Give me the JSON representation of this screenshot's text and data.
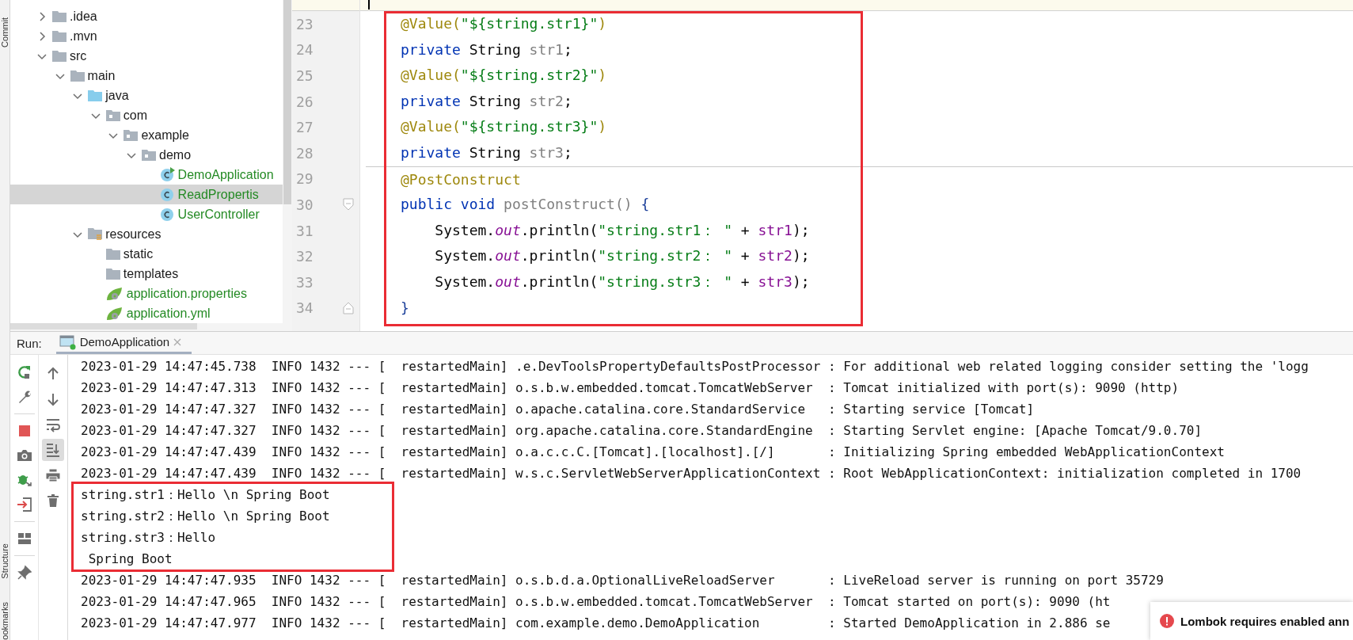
{
  "side_tabs": [
    {
      "label": "Commit"
    },
    {
      "label": "Structure"
    },
    {
      "label": "ookmarks"
    }
  ],
  "project_tree": [
    {
      "label": ".idea",
      "kind": "folder",
      "expanded": false,
      "selected": false
    },
    {
      "label": ".mvn",
      "kind": "folder",
      "expanded": false,
      "selected": false
    },
    {
      "label": "src",
      "kind": "folder",
      "expanded": true,
      "selected": false,
      "children": [
        {
          "label": "main",
          "kind": "folder",
          "expanded": true,
          "selected": false,
          "children": [
            {
              "label": "java",
              "kind": "source-folder",
              "expanded": true,
              "selected": false,
              "children": [
                {
                  "label": "com",
                  "kind": "package",
                  "expanded": true,
                  "selected": false,
                  "children": [
                    {
                      "label": "example",
                      "kind": "package",
                      "expanded": true,
                      "selected": false,
                      "children": [
                        {
                          "label": "demo",
                          "kind": "package",
                          "expanded": true,
                          "selected": false,
                          "children": [
                            {
                              "label": "DemoApplication",
                              "kind": "main-class",
                              "selected": false
                            },
                            {
                              "label": "ReadPropertis",
                              "kind": "class",
                              "selected": true
                            },
                            {
                              "label": "UserController",
                              "kind": "class",
                              "selected": false
                            }
                          ]
                        }
                      ]
                    }
                  ]
                }
              ]
            },
            {
              "label": "resources",
              "kind": "resources",
              "expanded": true,
              "selected": false,
              "children": [
                {
                  "label": "static",
                  "kind": "folder",
                  "selected": false
                },
                {
                  "label": "templates",
                  "kind": "folder",
                  "selected": false
                },
                {
                  "label": "application.properties",
                  "kind": "spring-config",
                  "selected": false
                },
                {
                  "label": "application.yml",
                  "kind": "spring-config",
                  "selected": false
                }
              ]
            }
          ]
        }
      ]
    }
  ],
  "editor": {
    "framed": true,
    "lines": [
      {
        "number": "23",
        "fold_start": false,
        "fold_end": false,
        "separator_above": false,
        "tokens": [
          {
            "text": "@Value(",
            "kind": "annotation"
          },
          {
            "text": "\"${string.str1}\"",
            "kind": "string"
          },
          {
            "text": ")",
            "kind": "annotation"
          }
        ]
      },
      {
        "number": "24",
        "fold_start": false,
        "fold_end": false,
        "separator_above": false,
        "tokens": [
          {
            "text": "private",
            "kind": "keyword"
          },
          {
            "text": " String ",
            "kind": "plain"
          },
          {
            "text": "str1",
            "kind": "unused"
          },
          {
            "text": ";",
            "kind": "plain"
          }
        ]
      },
      {
        "number": "25",
        "fold_start": false,
        "fold_end": false,
        "separator_above": false,
        "tokens": [
          {
            "text": "@Value(",
            "kind": "annotation"
          },
          {
            "text": "\"${string.str2}\"",
            "kind": "string"
          },
          {
            "text": ")",
            "kind": "annotation"
          }
        ]
      },
      {
        "number": "26",
        "fold_start": false,
        "fold_end": false,
        "separator_above": false,
        "tokens": [
          {
            "text": "private",
            "kind": "keyword"
          },
          {
            "text": " String ",
            "kind": "plain"
          },
          {
            "text": "str2",
            "kind": "unused"
          },
          {
            "text": ";",
            "kind": "plain"
          }
        ]
      },
      {
        "number": "27",
        "fold_start": false,
        "fold_end": false,
        "separator_above": false,
        "tokens": [
          {
            "text": "@Value(",
            "kind": "annotation"
          },
          {
            "text": "\"${string.str3}\"",
            "kind": "string"
          },
          {
            "text": ")",
            "kind": "annotation"
          }
        ]
      },
      {
        "number": "28",
        "fold_start": false,
        "fold_end": false,
        "separator_above": false,
        "tokens": [
          {
            "text": "private",
            "kind": "keyword"
          },
          {
            "text": " String ",
            "kind": "plain"
          },
          {
            "text": "str3",
            "kind": "unused"
          },
          {
            "text": ";",
            "kind": "plain"
          }
        ]
      },
      {
        "number": "29",
        "fold_start": false,
        "fold_end": false,
        "separator_above": true,
        "tokens": [
          {
            "text": "@PostConstruct",
            "kind": "annotation"
          }
        ]
      },
      {
        "number": "30",
        "fold_start": true,
        "fold_end": false,
        "separator_above": false,
        "tokens": [
          {
            "text": "public void",
            "kind": "keyword"
          },
          {
            "text": " postConstruct()",
            "kind": "unused"
          },
          {
            "text": " {",
            "kind": "brace"
          }
        ]
      },
      {
        "number": "31",
        "fold_start": false,
        "fold_end": false,
        "separator_above": false,
        "tokens": [
          {
            "text": "    System.",
            "kind": "plain"
          },
          {
            "text": "out",
            "kind": "static"
          },
          {
            "text": ".println(",
            "kind": "plain"
          },
          {
            "text": "\"string.str1： \"",
            "kind": "string"
          },
          {
            "text": " + ",
            "kind": "plain"
          },
          {
            "text": "str1",
            "kind": "field"
          },
          {
            "text": ");",
            "kind": "plain"
          }
        ]
      },
      {
        "number": "32",
        "fold_start": false,
        "fold_end": false,
        "separator_above": false,
        "tokens": [
          {
            "text": "    System.",
            "kind": "plain"
          },
          {
            "text": "out",
            "kind": "static"
          },
          {
            "text": ".println(",
            "kind": "plain"
          },
          {
            "text": "\"string.str2： \"",
            "kind": "string"
          },
          {
            "text": " + ",
            "kind": "plain"
          },
          {
            "text": "str2",
            "kind": "field"
          },
          {
            "text": ");",
            "kind": "plain"
          }
        ]
      },
      {
        "number": "33",
        "fold_start": false,
        "fold_end": false,
        "separator_above": false,
        "tokens": [
          {
            "text": "    System.",
            "kind": "plain"
          },
          {
            "text": "out",
            "kind": "static"
          },
          {
            "text": ".println(",
            "kind": "plain"
          },
          {
            "text": "\"string.str3： \"",
            "kind": "string"
          },
          {
            "text": " + ",
            "kind": "plain"
          },
          {
            "text": "str3",
            "kind": "field"
          },
          {
            "text": ");",
            "kind": "plain"
          }
        ]
      },
      {
        "number": "34",
        "fold_start": false,
        "fold_end": true,
        "separator_above": false,
        "tokens": [
          {
            "text": "}",
            "kind": "brace"
          }
        ]
      }
    ]
  },
  "run_panel": {
    "title": "Run:",
    "tabs": [
      {
        "label": "DemoApplication",
        "selected": true
      }
    ],
    "console_toolbar": [
      {
        "kind": "up",
        "on": false
      },
      {
        "kind": "down",
        "on": false
      },
      {
        "kind": "soft-wrap",
        "on": false
      },
      {
        "kind": "scroll-to-end",
        "on": true
      },
      {
        "kind": "print",
        "on": false
      },
      {
        "kind": "trash",
        "on": false
      }
    ],
    "console": [
      {
        "framed": false,
        "lines": [
          "2023-01-29 14:47:45.738  INFO 1432 --- [  restartedMain] .e.DevToolsPropertyDefaultsPostProcessor : For additional web related logging consider setting the 'logg",
          "2023-01-29 14:47:47.313  INFO 1432 --- [  restartedMain] o.s.b.w.embedded.tomcat.TomcatWebServer  : Tomcat initialized with port(s): 9090 (http)",
          "2023-01-29 14:47:47.327  INFO 1432 --- [  restartedMain] o.apache.catalina.core.StandardService   : Starting service [Tomcat]",
          "2023-01-29 14:47:47.327  INFO 1432 --- [  restartedMain] org.apache.catalina.core.StandardEngine  : Starting Servlet engine: [Apache Tomcat/9.0.70]",
          "2023-01-29 14:47:47.439  INFO 1432 --- [  restartedMain] o.a.c.c.C.[Tomcat].[localhost].[/]       : Initializing Spring embedded WebApplicationContext",
          "2023-01-29 14:47:47.439  INFO 1432 --- [  restartedMain] w.s.c.ServletWebServerApplicationContext : Root WebApplicationContext: initialization completed in 1700"
        ]
      },
      {
        "framed": true,
        "lines": [
          "string.str1：Hello \\n Spring Boot",
          "string.str2：Hello \\n Spring Boot",
          "string.str3：Hello",
          " Spring Boot"
        ]
      },
      {
        "framed": false,
        "lines": [
          "2023-01-29 14:47:47.935  INFO 1432 --- [  restartedMain] o.s.b.d.a.OptionalLiveReloadServer       : LiveReload server is running on port 35729",
          "2023-01-29 14:47:47.965  INFO 1432 --- [  restartedMain] o.s.b.w.embedded.tomcat.TomcatWebServer  : Tomcat started on port(s): 9090 (ht",
          "2023-01-29 14:47:47.977  INFO 1432 --- [  restartedMain] com.example.demo.DemoApplication         : Started DemoApplication in 2.886 se"
        ]
      }
    ]
  },
  "notification": {
    "kind": "error",
    "text": "Lombok requires enabled ann"
  }
}
